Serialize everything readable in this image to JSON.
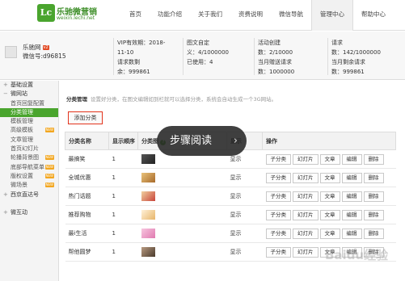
{
  "header": {
    "logo_badge": "Lc",
    "logo_name": "乐驰微营销",
    "logo_url": "weixin.lechi.net",
    "nav": [
      "首页",
      "功能介绍",
      "关于我们",
      "资费说明",
      "微信导航",
      "管理中心",
      "帮助中心"
    ],
    "active_nav": "管理中心"
  },
  "account": {
    "name": "乐驰网",
    "badge": "v2",
    "id": "微信号:d96815"
  },
  "stats": {
    "vip_label": "VIP有效期：2018-",
    "vip_date": "11-10",
    "req_label": "请求数剩",
    "req_value": "余：999861",
    "media_label": "图文自定",
    "media_value": "义：4/1000000",
    "used_label": "已使用：4",
    "activity_label": "活动创建",
    "activity_value": "数：2/10000",
    "month_req_label": "当月赠送请求",
    "month_req_value": "数：1000000",
    "request_label": "请求",
    "request_value": "数：142/1000000",
    "month_remain_label": "当月剩余请求",
    "month_remain_value": "数：999861"
  },
  "sidebar": [
    {
      "label": "基础设置",
      "type": "group",
      "sym": "+"
    },
    {
      "label": "微网站",
      "type": "group",
      "sym": "−"
    },
    {
      "label": "首页回复配置",
      "type": "sub"
    },
    {
      "label": "分类管理",
      "type": "sub",
      "active": true
    },
    {
      "label": "模板管理",
      "type": "sub"
    },
    {
      "label": "高级模板",
      "type": "sub",
      "badge": "NEW"
    },
    {
      "label": "文章管理",
      "type": "sub"
    },
    {
      "label": "首页幻灯片",
      "type": "sub"
    },
    {
      "label": "轮播背景图",
      "type": "sub",
      "badge": "NEW"
    },
    {
      "label": "底部导航菜单",
      "type": "sub",
      "badge": "NEW"
    },
    {
      "label": "版权设置",
      "type": "sub",
      "badge": "NEW"
    },
    {
      "label": "微场景",
      "type": "sub",
      "badge": "NEW"
    },
    {
      "label": "西京直达号",
      "type": "group",
      "sym": "+"
    },
    {
      "label": "",
      "type": "sub"
    },
    {
      "label": "微互动",
      "type": "group",
      "sym": "+"
    }
  ],
  "main": {
    "section_title": "分类管理",
    "tip": "设置好分类，在图文编辑如到栏就可以选择分类，系统会自动生成一个3G网站。",
    "add_button": "添加分类",
    "columns": [
      "分类名称",
      "显示顺序",
      "分类图",
      "显示",
      "操作"
    ],
    "rows": [
      {
        "name": "最搞笑",
        "order": "1",
        "status": "显示",
        "thumb": "#3a3a3a"
      },
      {
        "name": "全城优惠",
        "order": "1",
        "status": "显示",
        "thumb": "#d8a24a"
      },
      {
        "name": "热门话题",
        "order": "1",
        "status": "显示",
        "thumb": "#c9443a"
      },
      {
        "name": "推荐购物",
        "order": "1",
        "status": "显示",
        "thumb": "#e7c58a"
      },
      {
        "name": "最i生活",
        "order": "1",
        "status": "显示",
        "thumb": "#e07ab0"
      },
      {
        "name": "帮他圆梦",
        "order": "1",
        "status": "显示",
        "thumb": "#6e5a48"
      }
    ],
    "row_actions": [
      "子分类",
      "幻灯片",
      "文章",
      "编辑",
      "删除"
    ]
  },
  "overlay": {
    "label": "步骤阅读",
    "arrow": "›"
  },
  "watermark": "Baidu经验"
}
